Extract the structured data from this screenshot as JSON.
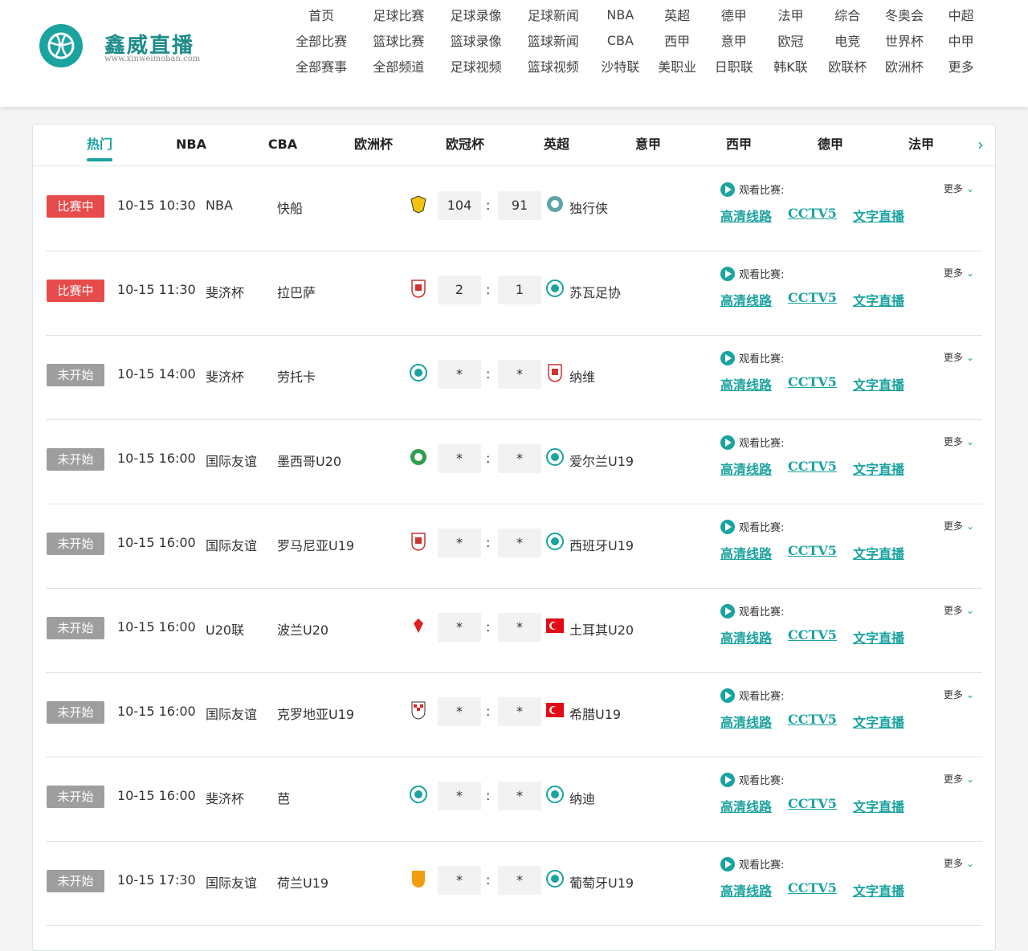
{
  "brand": {
    "name": "鑫威直播",
    "sub": "www.xinweimoban.com"
  },
  "nav": [
    [
      "首页",
      "足球比赛",
      "足球录像",
      "足球新闻",
      "NBA",
      "英超",
      "德甲",
      "法甲",
      "综合",
      "冬奥会",
      "中超"
    ],
    [
      "全部比赛",
      "篮球比赛",
      "篮球录像",
      "篮球新闻",
      "CBA",
      "西甲",
      "意甲",
      "欧冠",
      "电竞",
      "世界杯",
      "中甲"
    ],
    [
      "全部赛事",
      "全部频道",
      "足球视频",
      "篮球视频",
      "沙特联",
      "美职业",
      "日职联",
      "韩K联",
      "欧联杯",
      "欧洲杯",
      "更多"
    ]
  ],
  "tabs": [
    "热门",
    "NBA",
    "CBA",
    "欧洲杯",
    "欧冠杯",
    "英超",
    "意甲",
    "西甲",
    "德甲",
    "法甲"
  ],
  "active_tab": "热门",
  "colors": {
    "accent": "#1aa3a0",
    "live": "#e84b4b",
    "pending": "#9e9e9e"
  },
  "labels": {
    "watch": "观看比赛:",
    "more": "更多",
    "link1": "高清线路",
    "link2": "CCTV5",
    "link3": "文字直播"
  },
  "matches": [
    {
      "status": "比赛中",
      "live": true,
      "time": "10-15 10:30",
      "league": "NBA",
      "home": "快船",
      "home_score": "104",
      "away_score": "91",
      "away": "独行侠",
      "home_icon": "clippers-icon",
      "away_icon": "mavericks-icon"
    },
    {
      "status": "比赛中",
      "live": true,
      "time": "10-15 11:30",
      "league": "斐济杯",
      "home": "拉巴萨",
      "home_score": "2",
      "away_score": "1",
      "away": "苏瓦足协",
      "home_icon": "shield-icon",
      "away_icon": "crest-icon"
    },
    {
      "status": "未开始",
      "live": false,
      "time": "10-15 14:00",
      "league": "斐济杯",
      "home": "劳托卡",
      "home_score": "*",
      "away_score": "*",
      "away": "纳维",
      "home_icon": "crest-icon",
      "away_icon": "shield-icon"
    },
    {
      "status": "未开始",
      "live": false,
      "time": "10-15 16:00",
      "league": "国际友谊",
      "home": "墨西哥U20",
      "home_score": "*",
      "away_score": "*",
      "away": "爱尔兰U19",
      "home_icon": "ball-icon",
      "away_icon": "crest-icon"
    },
    {
      "status": "未开始",
      "live": false,
      "time": "10-15 16:00",
      "league": "国际友谊",
      "home": "罗马尼亚U19",
      "home_score": "*",
      "away_score": "*",
      "away": "西班牙U19",
      "home_icon": "shield-icon",
      "away_icon": "crest-icon"
    },
    {
      "status": "未开始",
      "live": false,
      "time": "10-15 16:00",
      "league": "U20联",
      "home": "波兰U20",
      "home_score": "*",
      "away_score": "*",
      "away": "土耳其U20",
      "home_icon": "eagle-icon",
      "away_icon": "flag-icon"
    },
    {
      "status": "未开始",
      "live": false,
      "time": "10-15 16:00",
      "league": "国际友谊",
      "home": "克罗地亚U19",
      "home_score": "*",
      "away_score": "*",
      "away": "希腊U19",
      "home_icon": "checker-icon",
      "away_icon": "flag-icon"
    },
    {
      "status": "未开始",
      "live": false,
      "time": "10-15 16:00",
      "league": "斐济杯",
      "home": "芭",
      "home_score": "*",
      "away_score": "*",
      "away": "纳迪",
      "home_icon": "crest-icon",
      "away_icon": "crest-icon"
    },
    {
      "status": "未开始",
      "live": false,
      "time": "10-15 17:30",
      "league": "国际友谊",
      "home": "荷兰U19",
      "home_score": "*",
      "away_score": "*",
      "away": "葡萄牙U19",
      "home_icon": "lion-icon",
      "away_icon": "crest-icon"
    }
  ]
}
